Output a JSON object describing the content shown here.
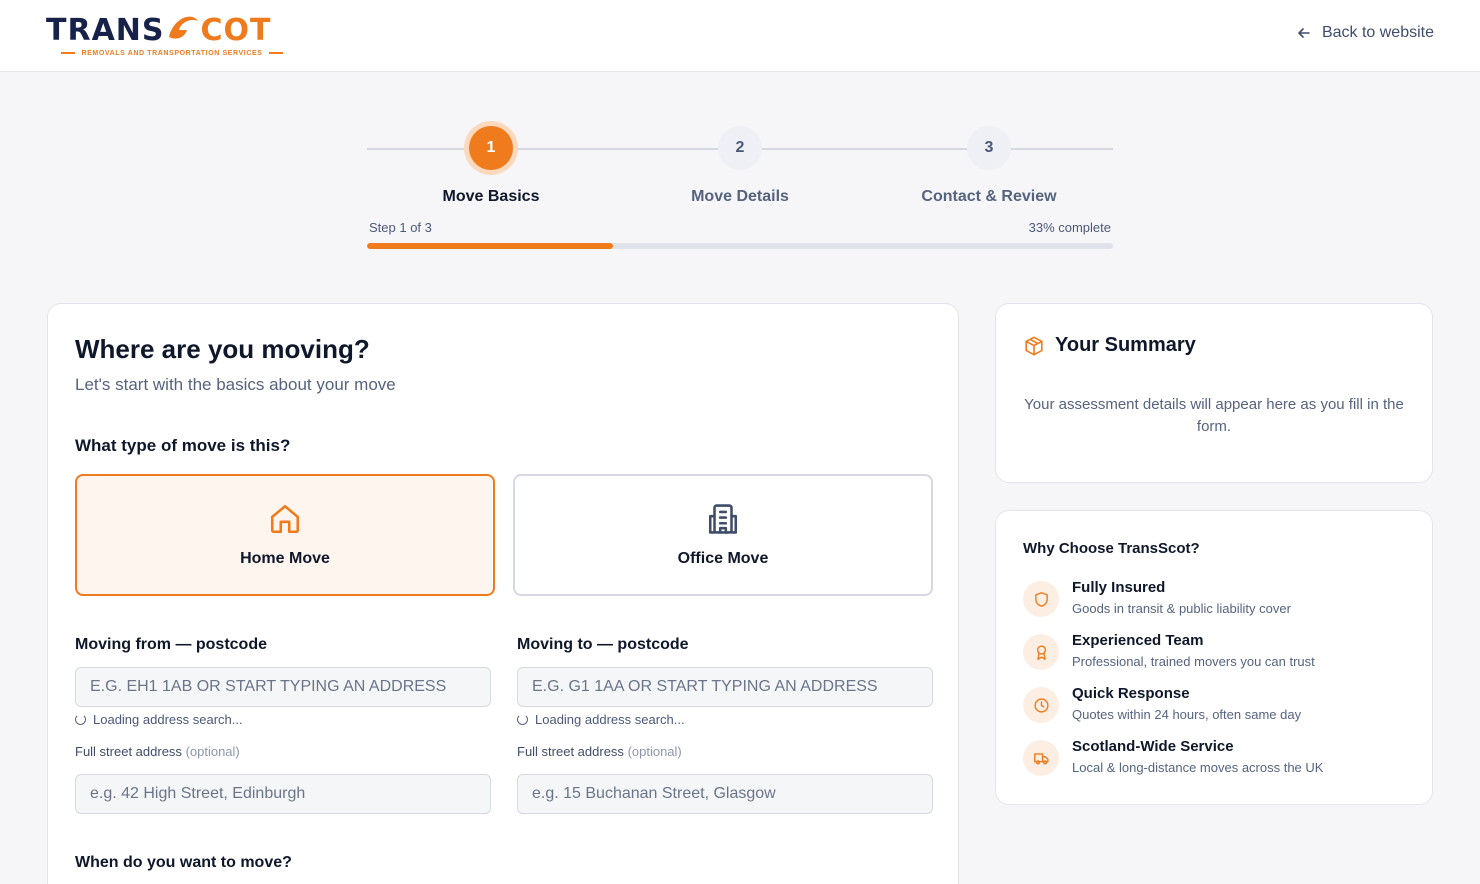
{
  "brand": {
    "logo_part1": "TRANS",
    "logo_part2": "COT",
    "tagline": "REMOVALS AND TRANSPORTATION SERVICES",
    "accent_color": "#f07b1d",
    "navy_color": "#16224a"
  },
  "header": {
    "back_label": "Back to website",
    "back_icon": "arrow-left-icon"
  },
  "stepper": {
    "steps": [
      {
        "number": "1",
        "label": "Move Basics",
        "active": true
      },
      {
        "number": "2",
        "label": "Move Details",
        "active": false
      },
      {
        "number": "3",
        "label": "Contact & Review",
        "active": false
      }
    ],
    "step_text": "Step 1 of 3",
    "complete_text": "33% complete",
    "progress_percent": 33
  },
  "form": {
    "title": "Where are you moving?",
    "subtitle": "Let's start with the basics about your move",
    "move_type_question": "What type of move is this?",
    "move_types": [
      {
        "label": "Home Move",
        "icon": "home-icon",
        "selected": true
      },
      {
        "label": "Office Move",
        "icon": "building-icon",
        "selected": false
      }
    ],
    "from": {
      "label": "Moving from — postcode",
      "placeholder": "e.g. EH1 1AB or start typing an address",
      "loading_text": "Loading address search...",
      "street_label": "Full street address",
      "street_optional": "(optional)",
      "street_placeholder": "e.g. 42 High Street, Edinburgh"
    },
    "to": {
      "label": "Moving to — postcode",
      "placeholder": "e.g. G1 1AA or start typing an address",
      "loading_text": "Loading address search...",
      "street_label": "Full street address",
      "street_optional": "(optional)",
      "street_placeholder": "e.g. 15 Buchanan Street, Glasgow"
    },
    "when_question": "When do you want to move?"
  },
  "summary": {
    "title": "Your Summary",
    "icon": "package-icon",
    "text": "Your assessment details will appear here as you fill in the form."
  },
  "why": {
    "title": "Why Choose TransScot?",
    "items": [
      {
        "name": "Fully Insured",
        "desc": "Goods in transit & public liability cover",
        "icon": "shield-icon"
      },
      {
        "name": "Experienced Team",
        "desc": "Professional, trained movers you can trust",
        "icon": "award-icon"
      },
      {
        "name": "Quick Response",
        "desc": "Quotes within 24 hours, often same day",
        "icon": "clock-icon"
      },
      {
        "name": "Scotland-Wide Service",
        "desc": "Local & long-distance moves across the UK",
        "icon": "truck-icon"
      }
    ]
  }
}
